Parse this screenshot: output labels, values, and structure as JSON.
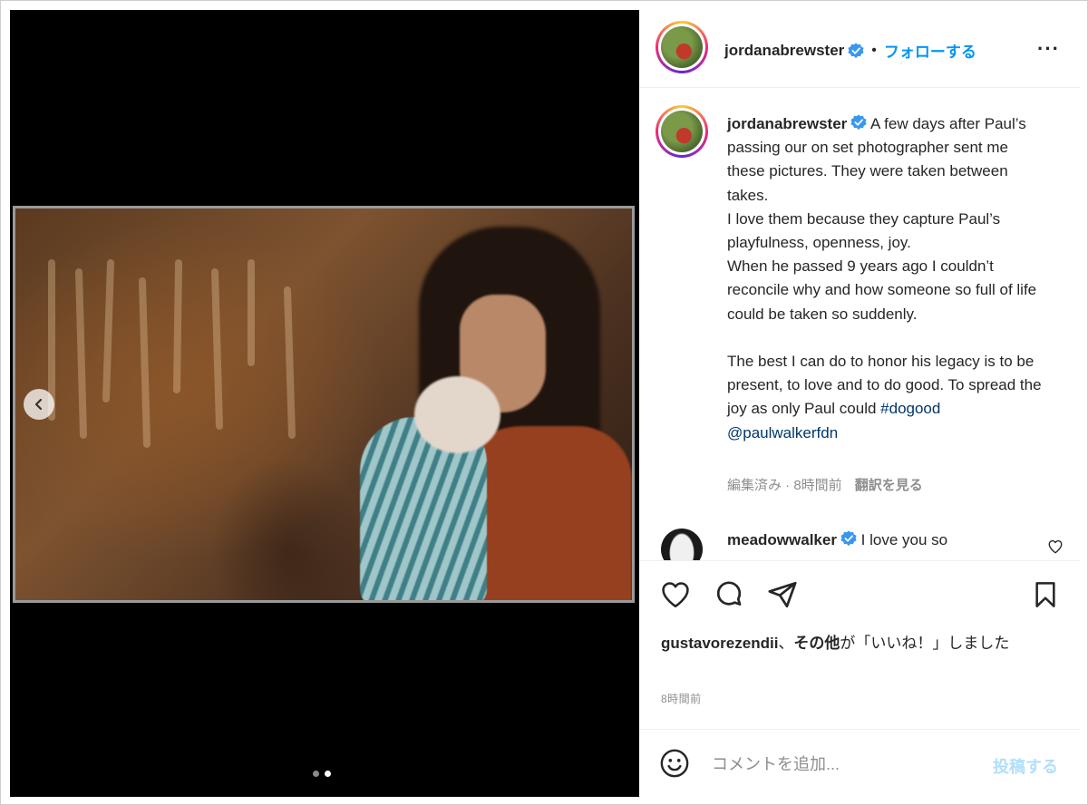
{
  "colors": {
    "accent": "#0095f6",
    "text": "#262626",
    "muted": "#8e8e8e",
    "post_disabled": "#b2dffc"
  },
  "media": {
    "carousel_dots": 2,
    "active_dot": 2,
    "prev_icon": "chevron-left-icon"
  },
  "header": {
    "username": "jordanabrewster",
    "separator": "•",
    "follow_label": "フォローする",
    "more_label": "···"
  },
  "caption": {
    "username": "jordanabrewster",
    "text_part1": " A few days after Paul’s passing our on set photographer sent me these pictures. They were taken between takes.\nI love them because they capture Paul’s playfulness, openness, joy.\nWhen he passed 9 years ago I couldn’t reconcile why and how someone so full of life could be taken so suddenly.\n\nThe best I can do to honor his legacy is to be present, to love and to do good. To spread the joy as only Paul could ",
    "hashtag": "#dogood",
    "mention": "@paulwalkerfdn",
    "meta_text": "編集済み · 8時間前",
    "translate_label": "翻訳を見る"
  },
  "reply": {
    "username": "meadowwalker",
    "text": " I love you so"
  },
  "likes": {
    "user": "gustavorezendii",
    "join": "、",
    "others": "その他",
    "suffix": "が「いいね！」しました"
  },
  "time_label": "8時間前",
  "comment_bar": {
    "placeholder": "コメントを追加...",
    "post_label": "投稿する"
  }
}
